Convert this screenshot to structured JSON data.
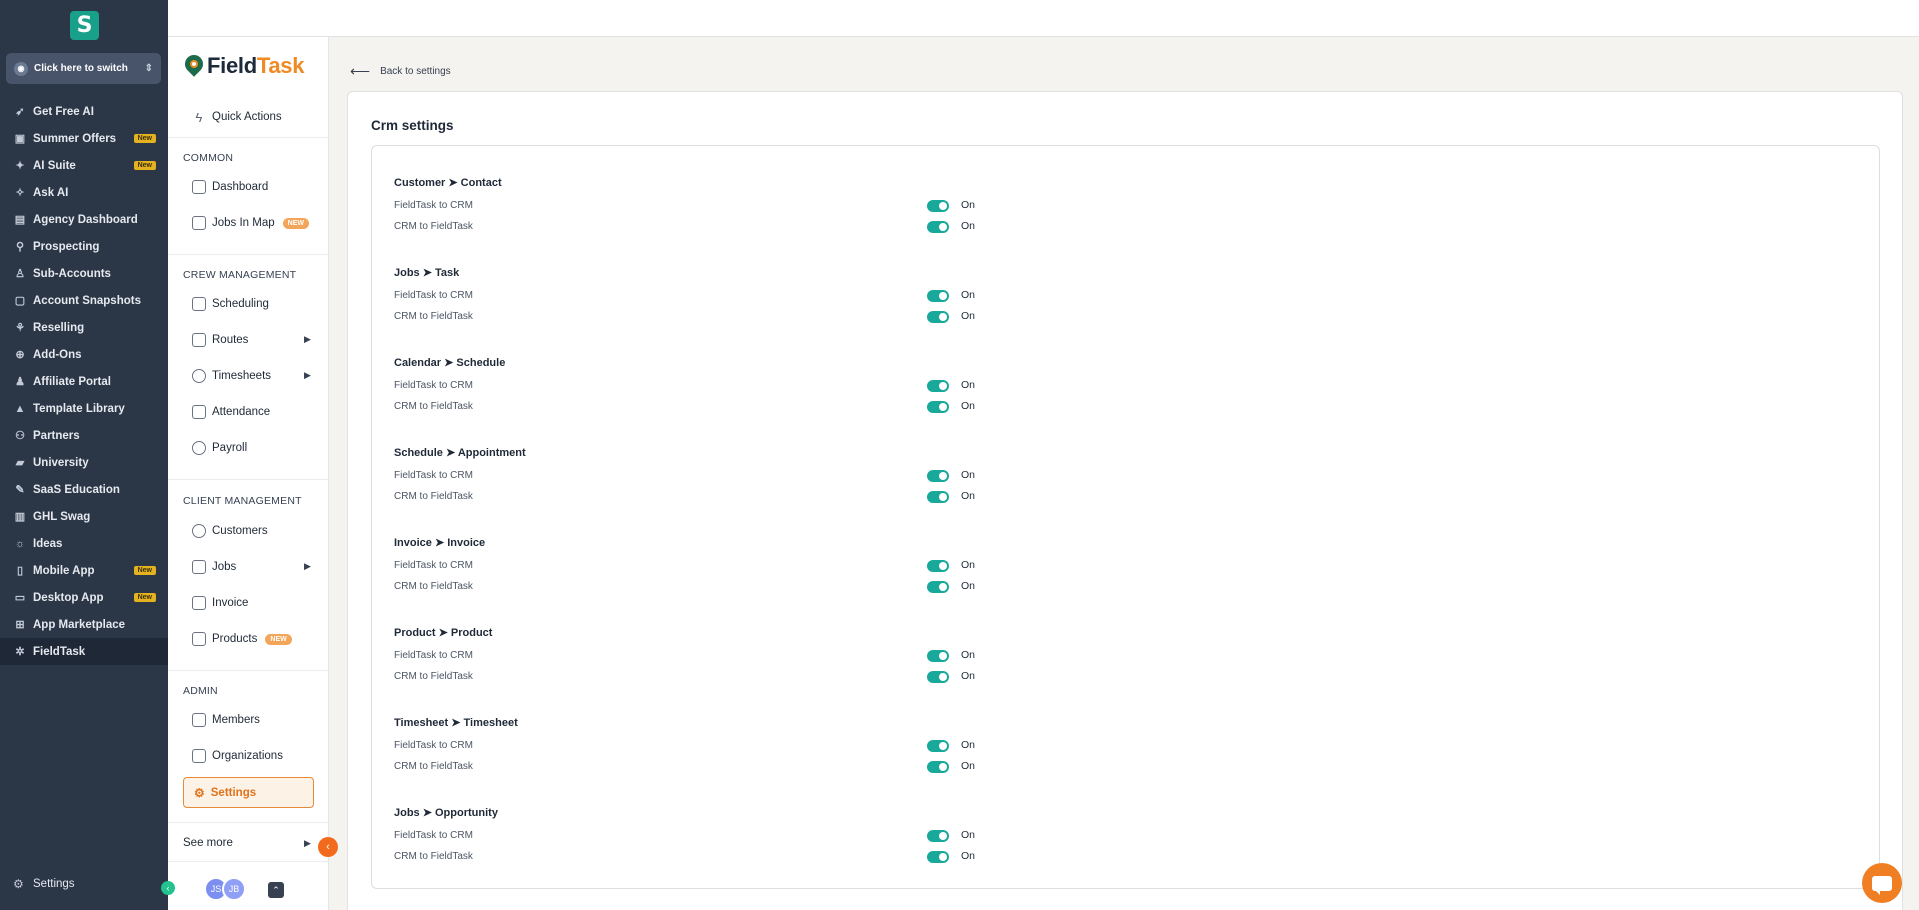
{
  "left_sidebar": {
    "switcher_label": "Click here to switch",
    "items": [
      {
        "label": "Get Free AI",
        "icon": "rocket-icon",
        "glyph": "➶"
      },
      {
        "label": "Summer Offers",
        "icon": "gift-icon",
        "glyph": "▣",
        "badge": "New"
      },
      {
        "label": "AI Suite",
        "icon": "sparkle-icon",
        "glyph": "✦",
        "badge": "New"
      },
      {
        "label": "Ask AI",
        "icon": "magic-icon",
        "glyph": "✧"
      },
      {
        "label": "Agency Dashboard",
        "icon": "dashboard-icon",
        "glyph": "▤"
      },
      {
        "label": "Prospecting",
        "icon": "prospecting-icon",
        "glyph": "⚲"
      },
      {
        "label": "Sub-Accounts",
        "icon": "user-icon",
        "glyph": "♙"
      },
      {
        "label": "Account Snapshots",
        "icon": "snapshot-icon",
        "glyph": "▢"
      },
      {
        "label": "Reselling",
        "icon": "reselling-icon",
        "glyph": "⚘"
      },
      {
        "label": "Add-Ons",
        "icon": "addon-icon",
        "glyph": "⊕"
      },
      {
        "label": "Affiliate Portal",
        "icon": "users-icon",
        "glyph": "♟"
      },
      {
        "label": "Template Library",
        "icon": "template-icon",
        "glyph": "▲"
      },
      {
        "label": "Partners",
        "icon": "handshake-icon",
        "glyph": "⚇"
      },
      {
        "label": "University",
        "icon": "graduation-icon",
        "glyph": "▰"
      },
      {
        "label": "SaaS Education",
        "icon": "education-icon",
        "glyph": "✎"
      },
      {
        "label": "GHL Swag",
        "icon": "swag-icon",
        "glyph": "▥"
      },
      {
        "label": "Ideas",
        "icon": "lightbulb-icon",
        "glyph": "☼"
      },
      {
        "label": "Mobile App",
        "icon": "mobile-icon",
        "glyph": "▯",
        "badge": "New"
      },
      {
        "label": "Desktop App",
        "icon": "desktop-icon",
        "glyph": "▭",
        "badge": "New"
      },
      {
        "label": "App Marketplace",
        "icon": "grid-icon",
        "glyph": "⊞"
      },
      {
        "label": "FieldTask",
        "icon": "fieldtask-icon",
        "glyph": "✲",
        "active": true
      }
    ],
    "bottom_label": "Settings"
  },
  "fieldtask_sidebar": {
    "brand_part1": "Field",
    "brand_part2": "Task",
    "quick_actions": "Quick Actions",
    "sections": {
      "common": "COMMON",
      "crew": "CREW MANAGEMENT",
      "client": "CLIENT MANAGEMENT",
      "admin": "ADMIN"
    },
    "items": {
      "dashboard": "Dashboard",
      "jobs_in_map": "Jobs In Map",
      "scheduling": "Scheduling",
      "routes": "Routes",
      "timesheets": "Timesheets",
      "attendance": "Attendance",
      "payroll": "Payroll",
      "customers": "Customers",
      "jobs": "Jobs",
      "invoice": "Invoice",
      "products": "Products",
      "members": "Members",
      "organizations": "Organizations",
      "settings": "Settings"
    },
    "new_badge": "NEW",
    "see_more": "See more",
    "avatars": [
      "JS",
      "JB"
    ]
  },
  "main": {
    "back_label": "Back to settings",
    "title": "Crm settings",
    "groups": [
      {
        "title": "Customer ➤ Contact",
        "rows": [
          {
            "label": "FieldTask to CRM",
            "state": "On"
          },
          {
            "label": "CRM to FieldTask",
            "state": "On"
          }
        ]
      },
      {
        "title": "Jobs ➤ Task",
        "rows": [
          {
            "label": "FieldTask to CRM",
            "state": "On"
          },
          {
            "label": "CRM to FieldTask",
            "state": "On"
          }
        ]
      },
      {
        "title": "Calendar ➤ Schedule",
        "rows": [
          {
            "label": "FieldTask to CRM",
            "state": "On"
          },
          {
            "label": "CRM to FieldTask",
            "state": "On"
          }
        ]
      },
      {
        "title": "Schedule ➤ Appointment",
        "rows": [
          {
            "label": "FieldTask to CRM",
            "state": "On"
          },
          {
            "label": "CRM to FieldTask",
            "state": "On"
          }
        ]
      },
      {
        "title": "Invoice ➤ Invoice",
        "rows": [
          {
            "label": "FieldTask to CRM",
            "state": "On"
          },
          {
            "label": "CRM to FieldTask",
            "state": "On"
          }
        ]
      },
      {
        "title": "Product ➤ Product",
        "rows": [
          {
            "label": "FieldTask to CRM",
            "state": "On"
          },
          {
            "label": "CRM to FieldTask",
            "state": "On"
          }
        ]
      },
      {
        "title": "Timesheet ➤ Timesheet",
        "rows": [
          {
            "label": "FieldTask to CRM",
            "state": "On"
          },
          {
            "label": "CRM to FieldTask",
            "state": "On"
          }
        ]
      },
      {
        "title": "Jobs ➤ Opportunity",
        "rows": [
          {
            "label": "FieldTask to CRM",
            "state": "On"
          },
          {
            "label": "CRM to FieldTask",
            "state": "On"
          }
        ]
      }
    ]
  },
  "colors": {
    "sidebar_bg": "#2b3647",
    "accent_orange": "#f08a24",
    "toggle_on": "#19a99b",
    "badge_yellow": "#e4b21f"
  }
}
